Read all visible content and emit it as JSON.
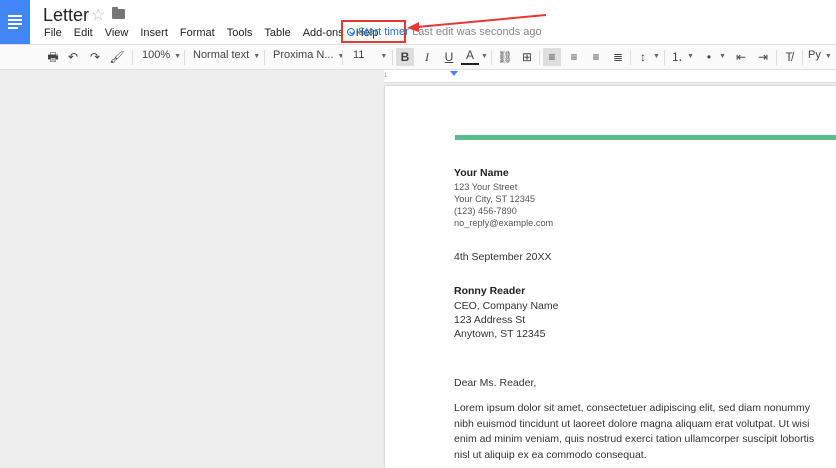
{
  "app": {
    "doc_title": "Letter"
  },
  "menu": {
    "items": [
      "File",
      "Edit",
      "View",
      "Insert",
      "Format",
      "Tools",
      "Table",
      "Add-ons",
      "Help"
    ],
    "start_timer": "Start timer",
    "last_edit": "Last edit was seconds ago"
  },
  "toolbar": {
    "zoom": "100%",
    "style": "Normal text",
    "font": "Proxima N...",
    "font_size": "11",
    "bold": "B",
    "italic": "I",
    "underline": "U",
    "text_color": "A",
    "input_tools": "Py"
  },
  "ruler": {
    "tick_1": "1"
  },
  "colors": {
    "accent_bar": "#57bb8a",
    "highlight": "#e53935",
    "link": "#1a73e8",
    "logo": "#4285f4"
  },
  "document": {
    "sender": {
      "name": "Your Name",
      "street": "123 Your Street",
      "city": "Your City, ST 12345",
      "phone": "(123) 456-7890",
      "email": "no_reply@example.com"
    },
    "date": "4th September 20XX",
    "recipient": {
      "name": "Ronny Reader",
      "title": "CEO, Company Name",
      "street": "123 Address St",
      "city": "Anytown, ST 12345"
    },
    "greeting": "Dear Ms. Reader,",
    "body": "Lorem ipsum dolor sit amet, consectetuer adipiscing elit, sed diam nonummy nibh euismod tincidunt ut laoreet dolore magna aliquam erat volutpat. Ut wisi enim ad minim veniam, quis nostrud exerci tation ullamcorper suscipit lobortis nisl ut aliquip ex ea commodo consequat."
  }
}
